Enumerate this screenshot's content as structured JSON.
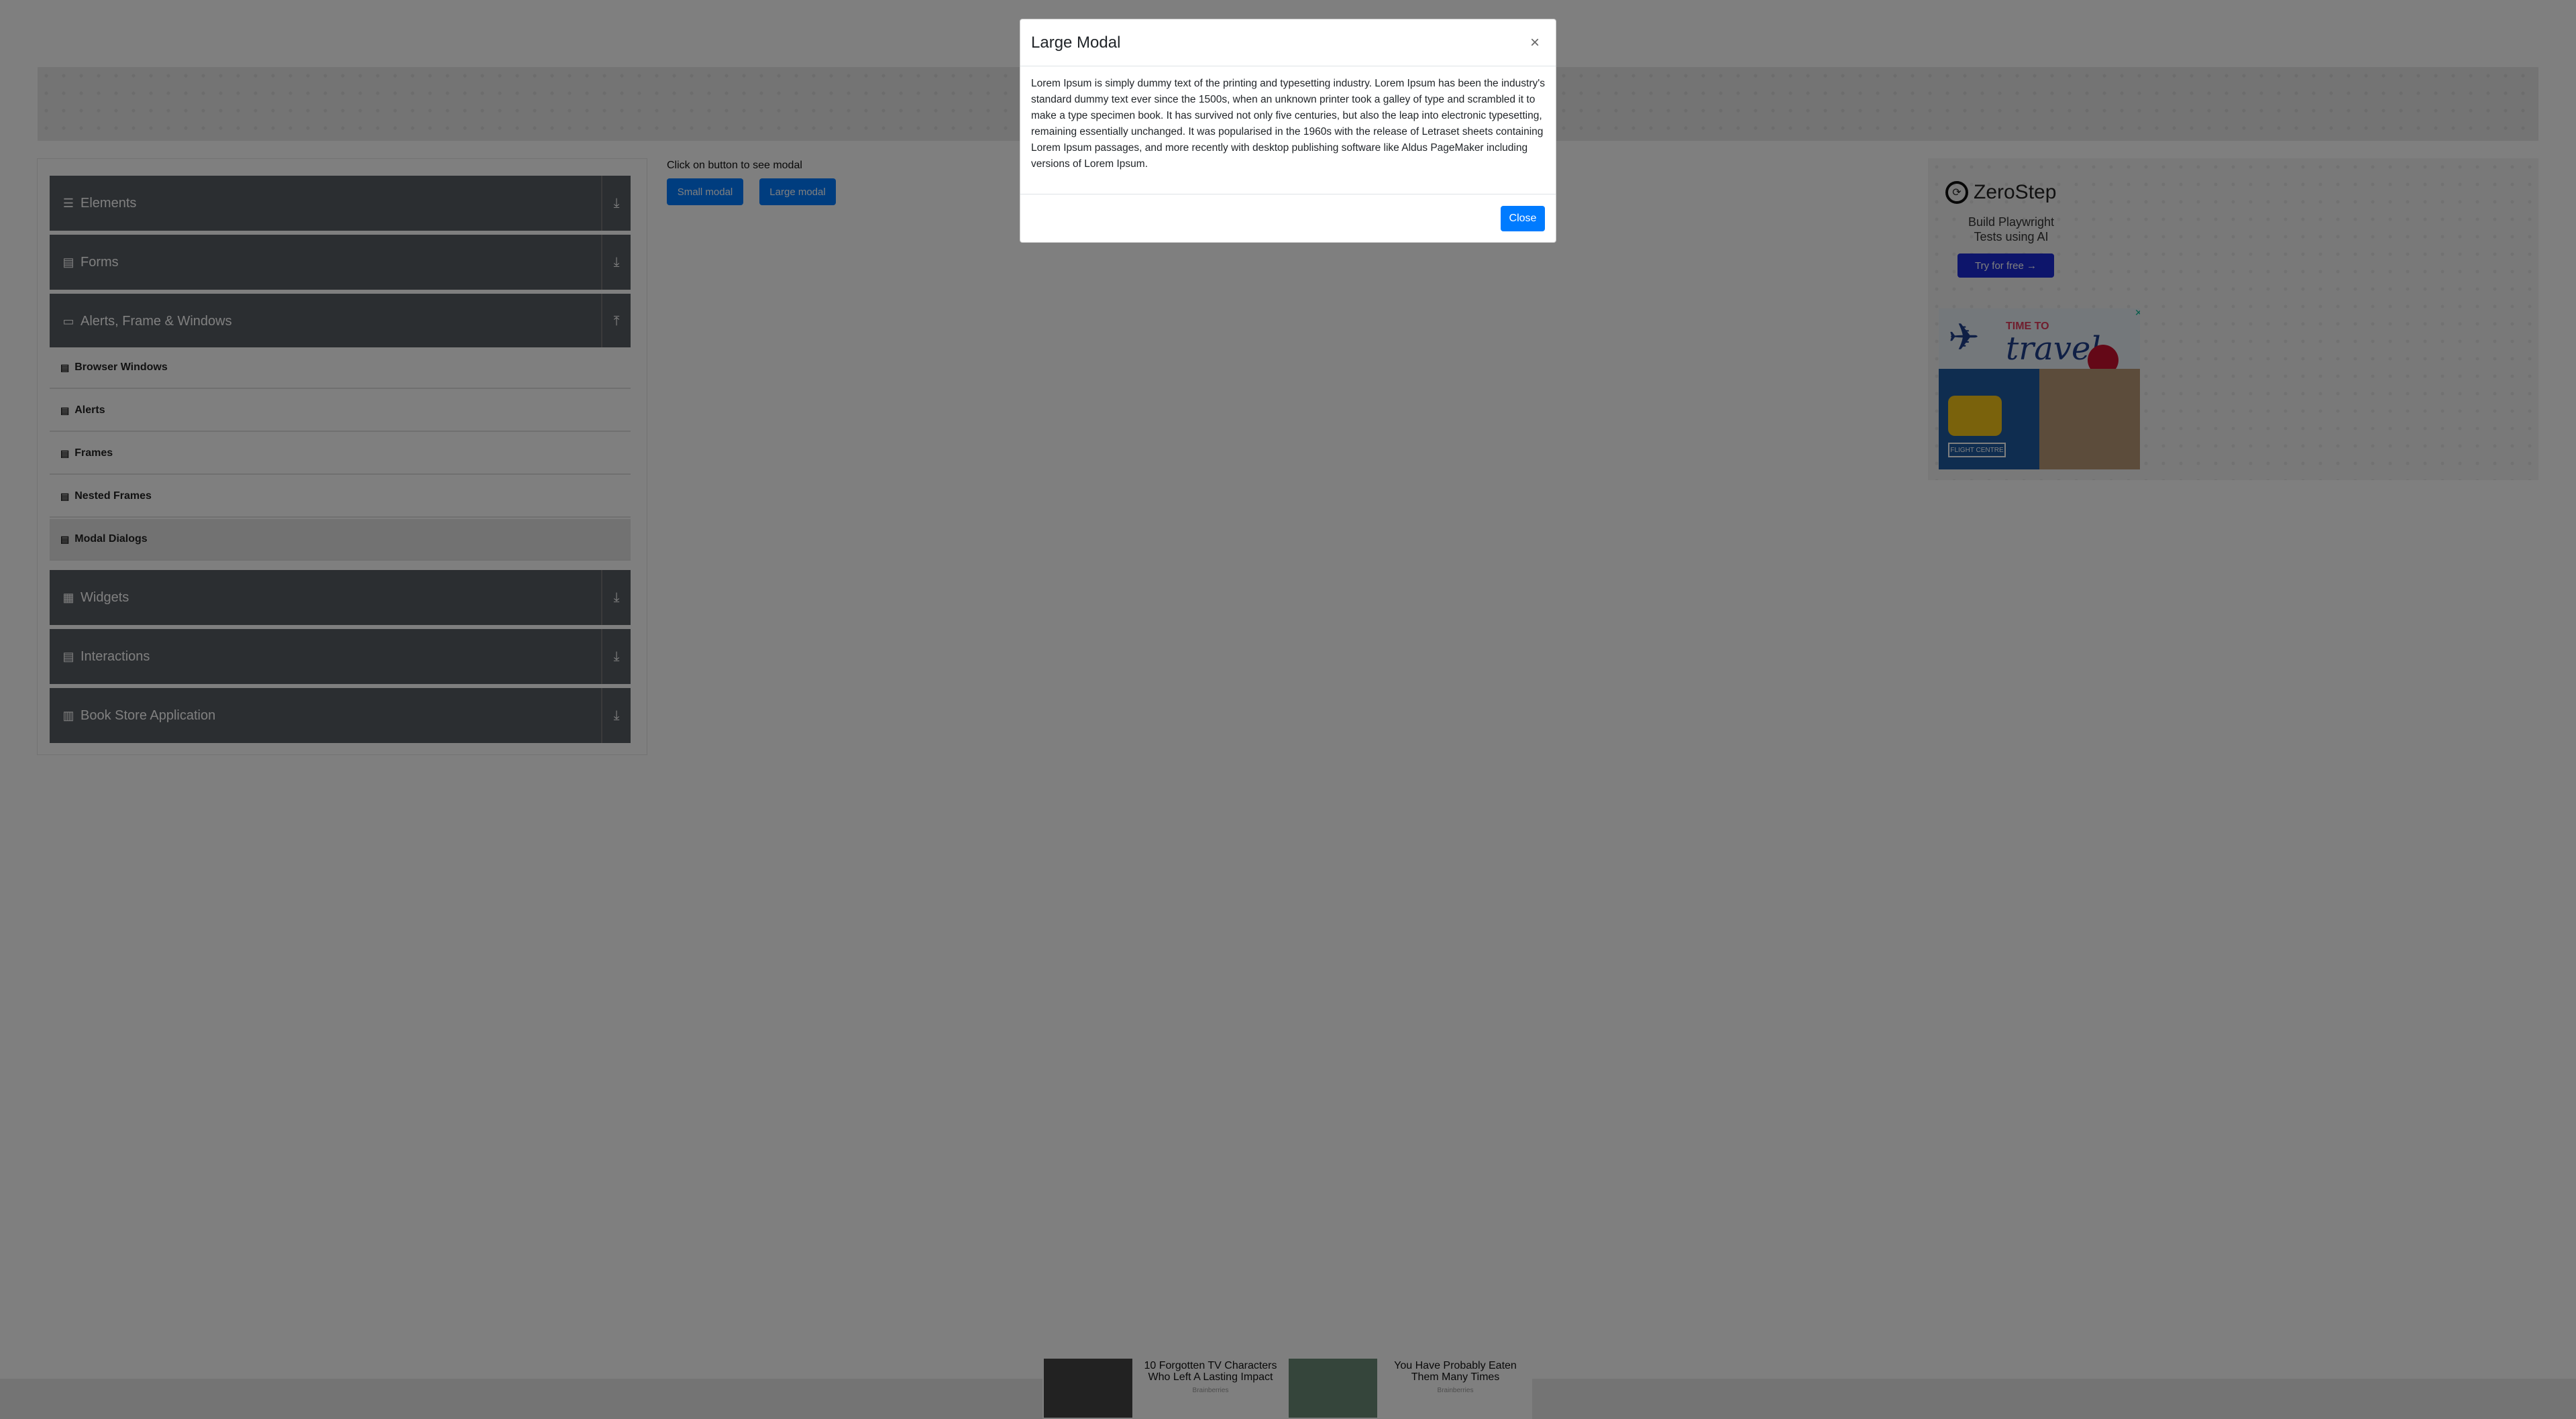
{
  "sidebar": {
    "groups": [
      {
        "label": "Elements",
        "icon": "list-icon"
      },
      {
        "label": "Forms",
        "icon": "form-icon"
      },
      {
        "label": "Alerts, Frame & Windows",
        "icon": "window-icon"
      },
      {
        "label": "Widgets",
        "icon": "grid-icon"
      },
      {
        "label": "Interactions",
        "icon": "interaction-icon"
      },
      {
        "label": "Book Store Application",
        "icon": "bookstore-icon"
      }
    ],
    "subitems": [
      {
        "label": "Browser Windows"
      },
      {
        "label": "Alerts"
      },
      {
        "label": "Frames"
      },
      {
        "label": "Nested Frames"
      },
      {
        "label": "Modal Dialogs"
      }
    ],
    "active_subitem": "Modal Dialogs"
  },
  "main": {
    "prompt": "Click on button to see modal",
    "small_modal_label": "Small modal",
    "large_modal_label": "Large modal"
  },
  "ad": {
    "brand": "ZeroStep",
    "tagline": "Build Playwright Tests using AI",
    "cta": "Try for free →",
    "travel_line1": "TIME TO",
    "travel_line2": "travel",
    "travel_store": "FLIGHT CENTRE"
  },
  "bottom_ads": [
    {
      "title": "10 Forgotten TV Characters Who Left A Lasting Impact",
      "source": "Brainberries"
    },
    {
      "title": "You Have Probably Eaten Them Many Times",
      "source": "Brainberries"
    }
  ],
  "modal": {
    "title": "Large Modal",
    "close_x": "×",
    "body": "Lorem Ipsum is simply dummy text of the printing and typesetting industry. Lorem Ipsum has been the industry's standard dummy text ever since the 1500s, when an unknown printer took a galley of type and scrambled it to make a type specimen book. It has survived not only five centuries, but also the leap into electronic typesetting, remaining essentially unchanged. It was popularised in the 1960s with the release of Letraset sheets containing Lorem Ipsum passages, and more recently with desktop publishing software like Aldus PageMaker including versions of Lorem Ipsum.",
    "close_label": "Close"
  },
  "colors": {
    "primary": "#007bff",
    "sidebar_group_bg": "#575c63",
    "overlay": "rgba(0,0,0,0.5)"
  }
}
